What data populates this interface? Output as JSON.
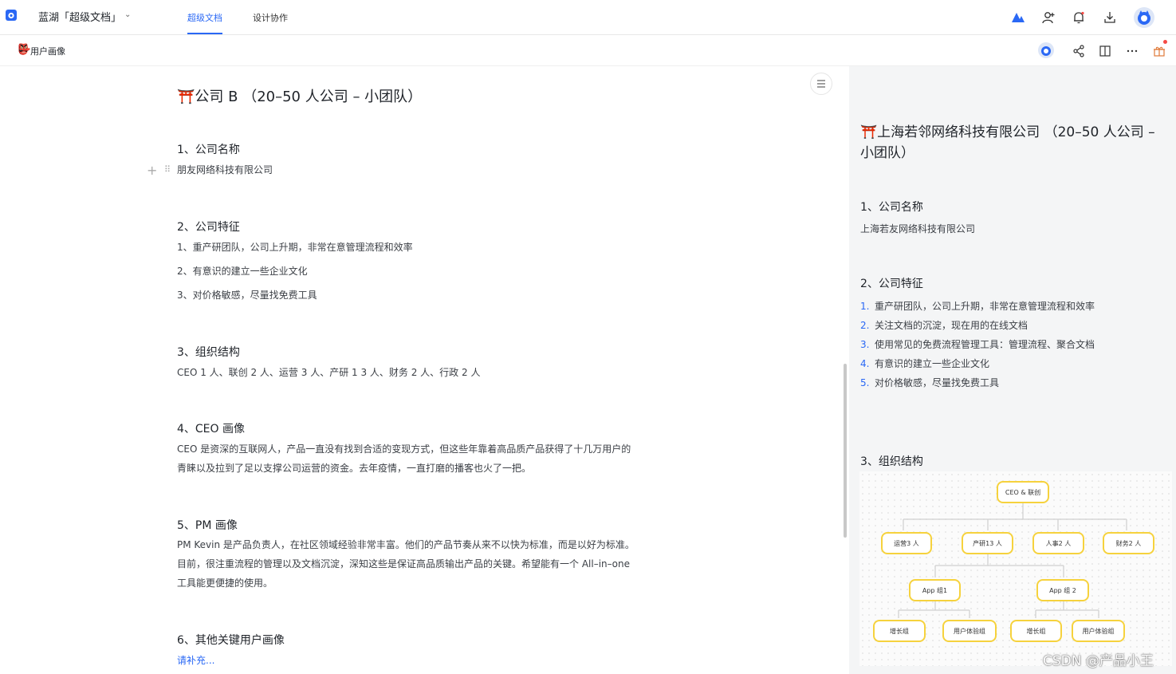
{
  "app": {
    "title": "蓝湖「超级文档」"
  },
  "tabs": [
    {
      "label": "超级文档",
      "active": true
    },
    {
      "label": "设计协作",
      "active": false
    }
  ],
  "toolbar_icons": [
    "lanhu-logo-icon",
    "add-member-icon",
    "bell-icon",
    "download-icon",
    "user-avatar"
  ],
  "breadcrumb": {
    "emoji": "👺",
    "doc_name": "用户画像"
  },
  "doc": {
    "title": "⛩️公司 B （20–50 人公司 – 小团队）",
    "sections": [
      {
        "heading": "1、公司名称",
        "lines": [
          "朋友网络科技有限公司"
        ]
      },
      {
        "heading": "2、公司特征",
        "lines": [
          "1、重产研团队，公司上升期，非常在意管理流程和效率",
          "2、有意识的建立一些企业文化",
          "3、对价格敏感，尽量找免费工具"
        ]
      },
      {
        "heading": "3、组织结构",
        "lines": [
          "CEO 1 人、联创 2 人、运营 3 人、产研 1 3 人、财务 2 人、行政 2 人"
        ]
      },
      {
        "heading": "4、CEO 画像",
        "lines": [
          "CEO 是资深的互联网人，产品一直没有找到合适的变现方式，但这些年靠着高品质产品获得了十几万用户的",
          "青睐以及拉到了足以支撑公司运营的资金。去年疫情，一直打磨的播客也火了一把。"
        ]
      },
      {
        "heading": "5、PM 画像",
        "lines": [
          "PM Kevin 是产品负责人，在社区领域经验非常丰富。他们的产品节奏从来不以快为标准，而是以好为标准。",
          "目前，很注重流程的管理以及文档沉淀，深知这些是保证高品质输出产品的关键。希望能有一个 All–in–one",
          "工具能更便捷的使用。"
        ]
      },
      {
        "heading": "6、其他关键用户画像",
        "lines": [
          "请补充..."
        ]
      }
    ]
  },
  "preview": {
    "title": "⛩️上海若邻网络科技有限公司 （20–50 人公司 – 小团队）",
    "h1": "1、公司名称",
    "company": "上海若友网络科技有限公司",
    "h2": "2、公司特征",
    "features": [
      {
        "n": "1.",
        "text": "重产研团队，公司上升期，非常在意管理流程和效率"
      },
      {
        "n": "2.",
        "text": "关注文档的沉淀，现在用的在线文档"
      },
      {
        "n": "3.",
        "text": "使用常见的免费流程管理工具：管理流程、聚合文档"
      },
      {
        "n": "4.",
        "text": "有意识的建立一些企业文化"
      },
      {
        "n": "5.",
        "text": "对价格敏感，尽量找免费工具"
      }
    ],
    "h3": "3、组织结构",
    "org": {
      "root": "CEO & 联创",
      "level1": [
        "运营3 人",
        "产研13 人",
        "人事2 人",
        "财务2 人"
      ],
      "level2": [
        "App 组1",
        "App 组 2"
      ],
      "level3": [
        "增长组",
        "用户体验组",
        "增长组",
        "用户体验组"
      ]
    }
  },
  "watermark": "CSDN @产品小王",
  "colors": {
    "accent": "#2a68f5",
    "node_border": "#f6d23d"
  }
}
